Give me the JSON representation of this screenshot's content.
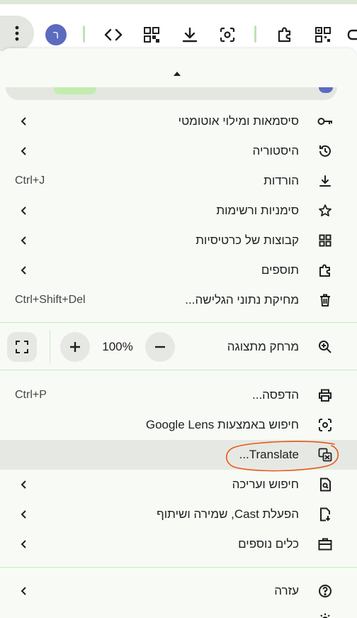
{
  "toolbar": {
    "avatar_letter": "ר",
    "icons": [
      "more-vert-icon",
      "code-icon",
      "qr-code-icon",
      "download-icon",
      "screenshot-icon",
      "extensions-icon",
      "qr-scan-icon",
      "gamepad-icon"
    ]
  },
  "menu": {
    "items_top": [
      {
        "label": "סיסמאות ומילוי אוטומטי",
        "icon": "key-icon",
        "submenu": true
      },
      {
        "label": "היסטוריה",
        "icon": "history-icon",
        "submenu": true
      },
      {
        "label": "הורדות",
        "icon": "download-icon",
        "shortcut": "Ctrl+J"
      },
      {
        "label": "סימניות ורשימות",
        "icon": "star-icon",
        "submenu": true
      },
      {
        "label": "קבוצות של כרטיסיות",
        "icon": "grid-icon",
        "submenu": true
      },
      {
        "label": "תוספים",
        "icon": "puzzle-icon",
        "submenu": true
      },
      {
        "label": "מחיקת נתוני הגלישה...",
        "icon": "trash-icon",
        "shortcut": "Ctrl+Shift+Del"
      }
    ],
    "zoom": {
      "label": "מרחק מתצוגה",
      "value": "100%"
    },
    "items_mid": [
      {
        "label": "הדפסה...",
        "icon": "print-icon",
        "shortcut": "Ctrl+P"
      },
      {
        "label": "חיפוש באמצעות Google Lens",
        "icon": "lens-icon"
      },
      {
        "label": "Translate...",
        "icon": "translate-icon",
        "highlighted": true
      },
      {
        "label": "חיפוש ועריכה",
        "icon": "find-edit-icon",
        "submenu": true
      },
      {
        "label": "הפעלת Cast, שמירה ושיתוף",
        "icon": "save-share-icon",
        "submenu": true
      },
      {
        "label": "כלים נוספים",
        "icon": "toolbox-icon",
        "submenu": true
      }
    ],
    "items_bottom": [
      {
        "label": "עזרה",
        "icon": "help-icon",
        "submenu": true
      }
    ]
  },
  "colors": {
    "accent_green": "#c2edaf",
    "highlight": "#e6e9e3",
    "annotation": "#e8571a"
  }
}
